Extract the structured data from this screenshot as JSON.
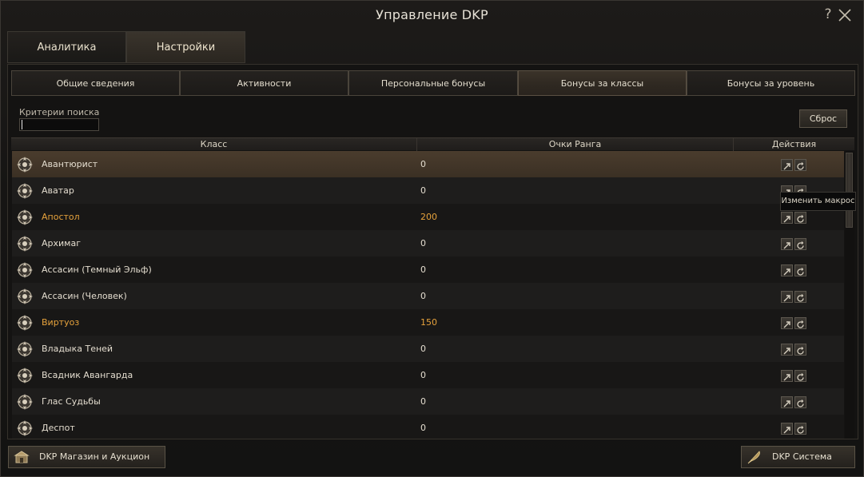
{
  "window": {
    "title": "Управление DKP",
    "help_label": "?",
    "close_icon": "close-icon"
  },
  "main_tabs": [
    {
      "label": "Аналитика",
      "active": false
    },
    {
      "label": "Настройки",
      "active": true
    }
  ],
  "sub_tabs": [
    {
      "label": "Общие сведения",
      "active": false
    },
    {
      "label": "Активности",
      "active": false
    },
    {
      "label": "Персональные бонусы",
      "active": false
    },
    {
      "label": "Бонусы за классы",
      "active": true
    },
    {
      "label": "Бонусы за уровень",
      "active": false
    }
  ],
  "search": {
    "label": "Критерии поиска",
    "value": "",
    "reset_label": "Сброс"
  },
  "table": {
    "headers": {
      "class": "Класс",
      "points": "Очки Ранга",
      "actions": "Действия"
    },
    "rows": [
      {
        "name": "Авантюрист",
        "points": "0",
        "highlight": false,
        "selected": true,
        "icon": "class-crest-icon"
      },
      {
        "name": "Аватар",
        "points": "0",
        "highlight": false,
        "selected": false,
        "icon": "class-crest-icon"
      },
      {
        "name": "Апостол",
        "points": "200",
        "highlight": true,
        "selected": false,
        "icon": "class-crest-icon"
      },
      {
        "name": "Архимаг",
        "points": "0",
        "highlight": false,
        "selected": false,
        "icon": "class-crest-icon"
      },
      {
        "name": "Ассасин (Темный Эльф)",
        "points": "0",
        "highlight": false,
        "selected": false,
        "icon": "class-crest-icon"
      },
      {
        "name": "Ассасин (Человек)",
        "points": "0",
        "highlight": false,
        "selected": false,
        "icon": "class-crest-icon"
      },
      {
        "name": "Виртуоз",
        "points": "150",
        "highlight": true,
        "selected": false,
        "icon": "class-crest-icon"
      },
      {
        "name": "Владыка Теней",
        "points": "0",
        "highlight": false,
        "selected": false,
        "icon": "class-crest-icon"
      },
      {
        "name": "Всадник Авангарда",
        "points": "0",
        "highlight": false,
        "selected": false,
        "icon": "class-crest-icon"
      },
      {
        "name": "Глас Судьбы",
        "points": "0",
        "highlight": false,
        "selected": false,
        "icon": "class-crest-icon"
      },
      {
        "name": "Деспот",
        "points": "0",
        "highlight": false,
        "selected": false,
        "icon": "class-crest-icon"
      }
    ],
    "actions_icons": [
      "edit-icon",
      "reset-icon"
    ]
  },
  "tooltip": {
    "text": "Изменить макрос"
  },
  "bottom": {
    "shop_label": "DKP Магазин и Аукцион",
    "system_label": "DKP Система"
  },
  "colors": {
    "highlight": "#e6a23c",
    "selected_row": "#4a3c2d"
  }
}
